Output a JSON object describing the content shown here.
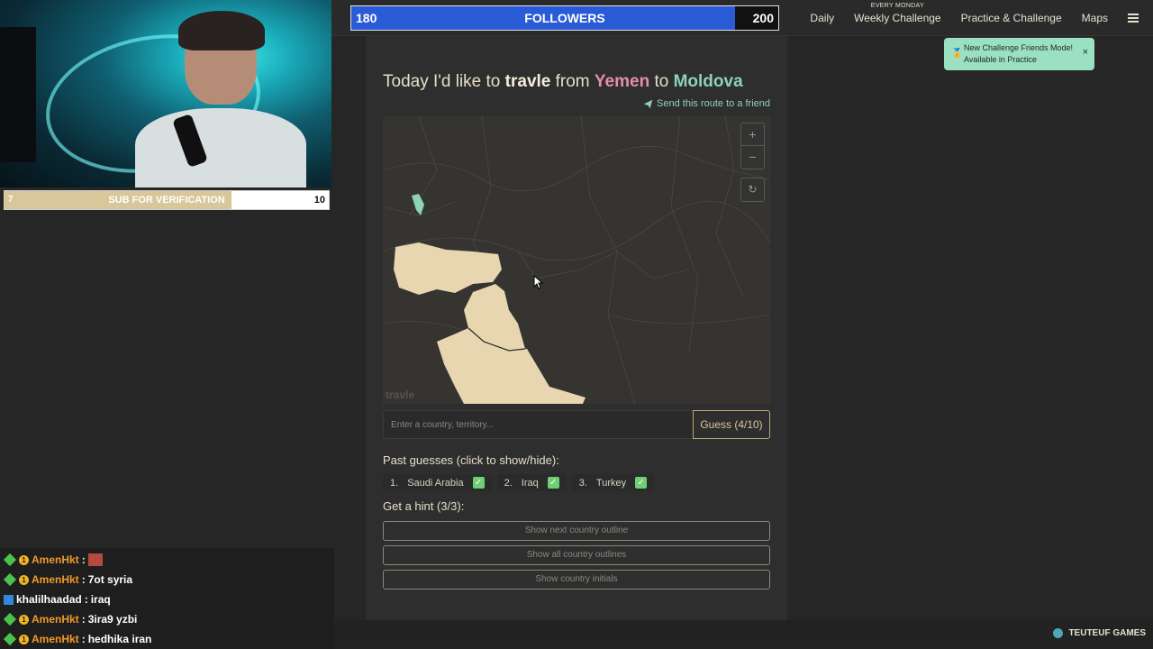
{
  "nav": {
    "daily": "Daily",
    "weekly_tagline": "EVERY MONDAY",
    "weekly": "Weekly Challenge",
    "practice": "Practice & Challenge",
    "maps": "Maps"
  },
  "toast": {
    "line1": "New Challenge Friends Mode!",
    "line2": "Available in Practice",
    "close": "×"
  },
  "followers": {
    "current": "180",
    "label": "FOLLOWERS",
    "goal": "200",
    "progress": 0.9
  },
  "subs": {
    "current": "7",
    "label": "SUB FOR VERIFICATION",
    "goal": "10",
    "progress": 0.7
  },
  "game": {
    "prefix": "Today I'd like to ",
    "brand": "travle",
    "from_word": " from ",
    "from": "Yemen",
    "to_word": " to ",
    "to": "Moldova",
    "share": "Send this route to a friend",
    "watermark": "travle",
    "zoom_in": "+",
    "zoom_out": "−",
    "reset": "↻",
    "input_placeholder": "Enter a country, territory...",
    "guess_label": "Guess (4/10)",
    "past_title": "Past guesses (click to show/hide):",
    "past": [
      {
        "num": "1.",
        "name": "Saudi Arabia"
      },
      {
        "num": "2.",
        "name": "Iraq"
      },
      {
        "num": "3.",
        "name": "Turkey"
      }
    ],
    "hint_title": "Get a hint (3/3):",
    "hints": [
      "Show next country outline",
      "Show all country outlines",
      "Show country initials"
    ]
  },
  "chat": [
    {
      "user": "AmenHkt",
      "text": "",
      "emote": true
    },
    {
      "user": "AmenHkt",
      "text": "7ot syria"
    },
    {
      "user": "khalilhaadad",
      "text": "iraq"
    },
    {
      "user": "AmenHkt",
      "text": "3ira9 yzbi"
    },
    {
      "user": "AmenHkt",
      "text": "hedhika iran"
    }
  ],
  "publisher": "TEUTEUF GAMES",
  "colors": {
    "accent": "#8fd2b4",
    "from": "#e58fa5",
    "land": "#e8d6b0",
    "followers": "#2a5bd6"
  }
}
